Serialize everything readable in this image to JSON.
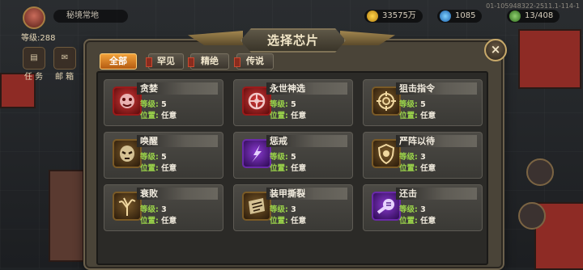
{
  "hud": {
    "player_name": "秘境常地",
    "player_level": "等级:288",
    "gold": "33575万",
    "gems": "1085",
    "capacity": "13/408",
    "build_id": "01-105948322-2511.1-114-1",
    "side_buttons": [
      "任 务",
      "邮 箱"
    ]
  },
  "modal": {
    "title": "选择芯片",
    "tabs": [
      {
        "label": "全部",
        "active": true
      },
      {
        "label": "罕见",
        "active": false
      },
      {
        "label": "精绝",
        "active": false
      },
      {
        "label": "传说",
        "active": false
      }
    ],
    "level_key": "等级:",
    "position_key": "位置:",
    "chips": [
      {
        "name": "贪婪",
        "level": "5",
        "position": "任意",
        "icon": "greed-icon",
        "tone": "red"
      },
      {
        "name": "永世神选",
        "level": "5",
        "position": "任意",
        "icon": "eternal-chosen-icon",
        "tone": "red"
      },
      {
        "name": "狙击指令",
        "level": "5",
        "position": "任意",
        "icon": "crosshair-icon",
        "tone": "gold"
      },
      {
        "name": "唤醒",
        "level": "5",
        "position": "任意",
        "icon": "awaken-mask-icon",
        "tone": "gold"
      },
      {
        "name": "惩戒",
        "level": "5",
        "position": "任意",
        "icon": "punish-blade-icon",
        "tone": "purple"
      },
      {
        "name": "严阵以待",
        "level": "3",
        "position": "任意",
        "icon": "ready-shield-icon",
        "tone": "gold"
      },
      {
        "name": "衰败",
        "level": "3",
        "position": "任意",
        "icon": "withered-tree-icon",
        "tone": "gold"
      },
      {
        "name": "装甲撕裂",
        "level": "3",
        "position": "任意",
        "icon": "armor-rip-icon",
        "tone": "gold"
      },
      {
        "name": "还击",
        "level": "3",
        "position": "任意",
        "icon": "counter-fist-icon",
        "tone": "purple"
      }
    ]
  },
  "colors": {
    "accent_tab": "#f2a23a",
    "key_green": "#9bd54a",
    "rare_red": "#d23a3a",
    "epic_purple": "#8a3ad0"
  }
}
